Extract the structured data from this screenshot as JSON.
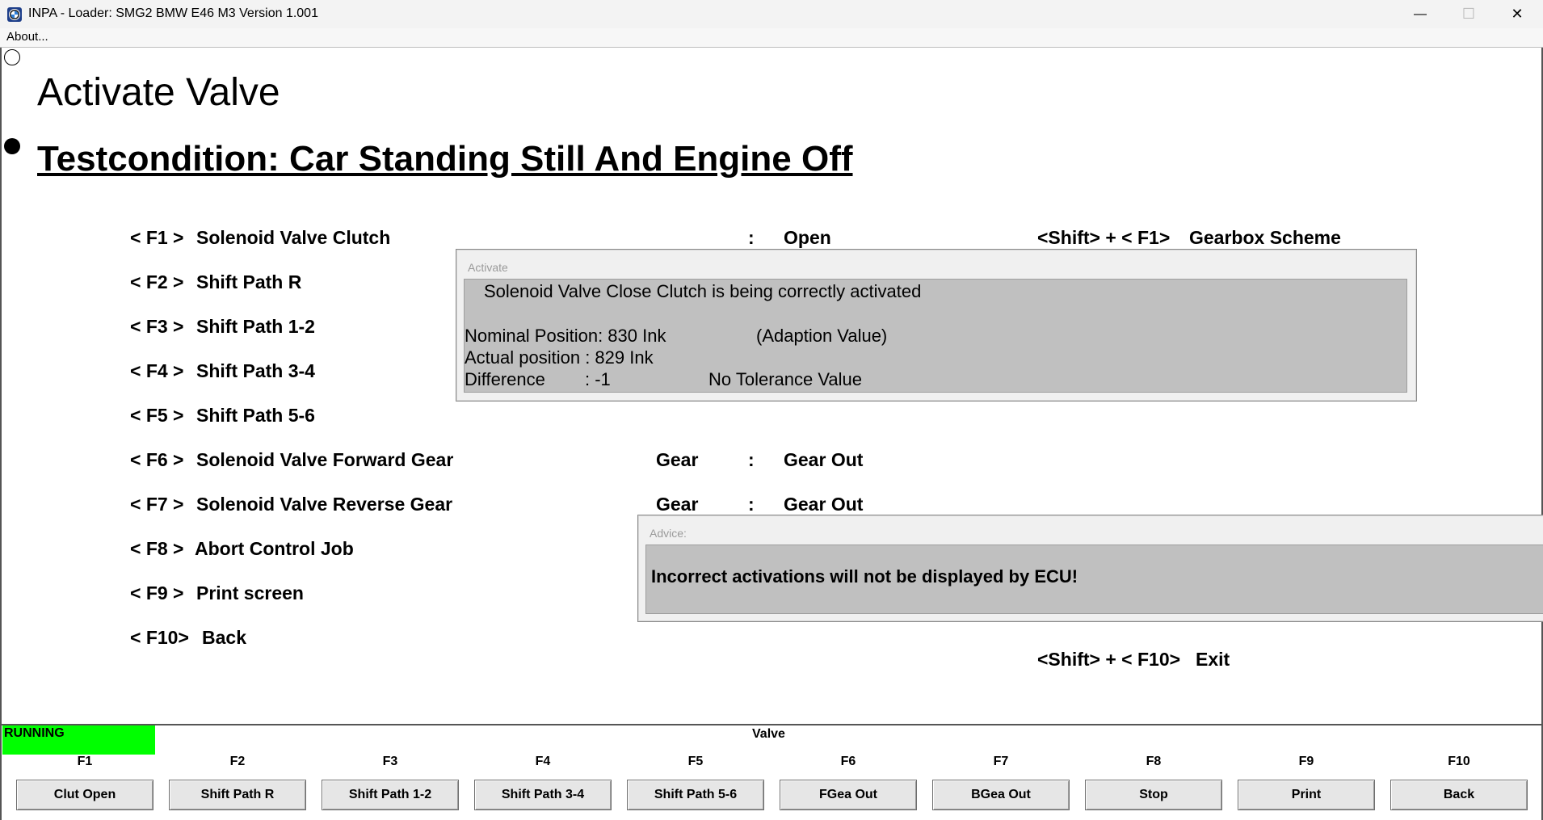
{
  "window": {
    "title": "INPA - Loader:  SMG2 BMW E46 M3 Version 1.001",
    "minimize_symbol": "—",
    "maximize_symbol": "☐",
    "close_symbol": "✕"
  },
  "menu": {
    "about": "About..."
  },
  "page": {
    "title": "Activate Valve",
    "testcondition": "Testcondition: Car Standing Still And Engine Off"
  },
  "fkeys": [
    {
      "key": "< F1 >",
      "label": "Solenoid Valve Clutch"
    },
    {
      "key": "< F2 >",
      "label": "Shift Path R"
    },
    {
      "key": "< F3 >",
      "label": "Shift Path 1-2"
    },
    {
      "key": "< F4 >",
      "label": "Shift Path 3-4"
    },
    {
      "key": "< F5 >",
      "label": "Shift Path 5-6"
    },
    {
      "key": "< F6 >",
      "label": "Solenoid Valve Forward Gear"
    },
    {
      "key": "< F7 >",
      "label": "Solenoid Valve Reverse Gear"
    },
    {
      "key": "< F8 >",
      "label": "Abort Control Job"
    },
    {
      "key": "< F9 >",
      "label": "Print screen"
    },
    {
      "key": "< F10>",
      "label": "Back"
    }
  ],
  "values": {
    "clutch_colon": ":",
    "clutch_state": "Open",
    "fwd_label": "Gear",
    "fwd_colon": ":",
    "fwd_state": "Gear Out",
    "rev_label": "Gear",
    "rev_colon": ":",
    "rev_state": "Gear Out"
  },
  "shortcuts": {
    "shift_f1": "<Shift> + < F1>",
    "shift_f1_label": "Gearbox Scheme",
    "shift_f10": "<Shift> + < F10>",
    "shift_f10_label": "Exit"
  },
  "activate_dialog": {
    "title": "Activate",
    "message": "Solenoid Valve Close Clutch is being correctly activated",
    "nominal": "Nominal Position: 830 Ink",
    "adaption": "(Adaption Value)",
    "actual": "Actual position  : 829 Ink",
    "difference_label": "Difference",
    "difference_value": ": -1",
    "tolerance": "No Tolerance Value"
  },
  "advice_dialog": {
    "title": "Advice:",
    "message": "Incorrect activations will not be displayed by ECU!"
  },
  "status": {
    "running": "RUNNING",
    "running_color": "#00ff00",
    "section": "Valve"
  },
  "function_bar": [
    {
      "key": "F1",
      "button": "Clut Open"
    },
    {
      "key": "F2",
      "button": "Shift Path R"
    },
    {
      "key": "F3",
      "button": "Shift Path 1-2"
    },
    {
      "key": "F4",
      "button": "Shift Path 3-4"
    },
    {
      "key": "F5",
      "button": "Shift Path 5-6"
    },
    {
      "key": "F6",
      "button": "FGea Out"
    },
    {
      "key": "F7",
      "button": "BGea Out"
    },
    {
      "key": "F8",
      "button": "Stop"
    },
    {
      "key": "F9",
      "button": "Print"
    },
    {
      "key": "F10",
      "button": "Back"
    }
  ]
}
